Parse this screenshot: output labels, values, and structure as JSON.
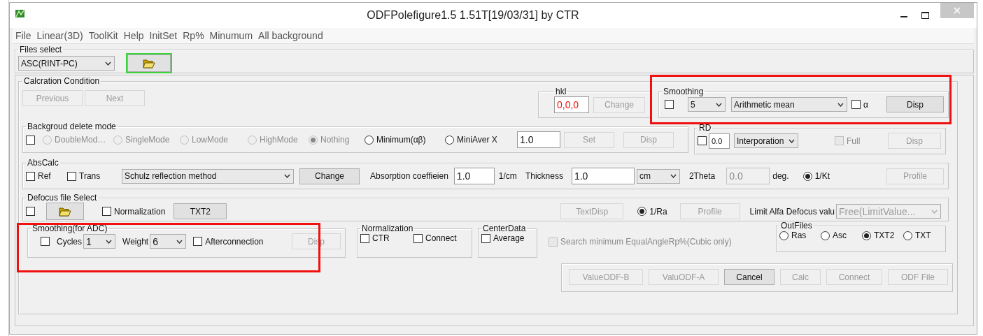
{
  "window": {
    "title": "ODFPolefigure1.5 1.51T[19/03/31] by CTR"
  },
  "menu": [
    "File",
    "Linear(3D)",
    "ToolKit",
    "Help",
    "InitSet",
    "Rp%",
    "Minumum",
    "All background"
  ],
  "files_select": {
    "label": "Files select",
    "format": "ASC(RINT-PC)"
  },
  "calc": {
    "label": "Calcration Condition"
  },
  "nav_buttons": [
    {
      "label": "Previous",
      "disabled": true
    },
    {
      "label": "Next",
      "disabled": true
    }
  ],
  "hkl": {
    "label": "hkl",
    "value": "0,0,0",
    "button": {
      "label": "Change",
      "disabled": true
    }
  },
  "smoothing": {
    "label": "Smoothing",
    "checked": false,
    "size": "5",
    "method": "Arithmetic mean",
    "alpha": {
      "label": "α",
      "checked": false
    },
    "button": {
      "label": "Disp",
      "disabled": false
    }
  },
  "background": {
    "label": "Backgroud delete mode",
    "checked": false,
    "modes": [
      {
        "label": "DoubleMod…",
        "selected": false,
        "disabled": true
      },
      {
        "label": "SingleMode",
        "selected": false,
        "disabled": true
      },
      {
        "label": "LowMode",
        "selected": false,
        "disabled": true
      },
      {
        "label": "HighMode",
        "selected": false,
        "disabled": true
      },
      {
        "label": "Nothing",
        "selected": true,
        "disabled": true
      },
      {
        "label": "Minimum(αβ)",
        "selected": false,
        "disabled": false
      },
      {
        "label": "MiniAver X",
        "selected": false,
        "disabled": false
      }
    ],
    "value": "1.0",
    "buttons": [
      {
        "label": "Set",
        "disabled": true
      },
      {
        "label": "Disp",
        "disabled": true
      }
    ]
  },
  "rd": {
    "label": "RD",
    "checked": false,
    "value": "0.0",
    "method": "Interporation",
    "full": {
      "label": "Full",
      "checked": false,
      "disabled": true
    },
    "button": {
      "label": "Disp",
      "disabled": true
    }
  },
  "abscalc": {
    "label": "AbsCalc",
    "options": [
      {
        "label": "Ref",
        "checked": false
      },
      {
        "label": "Trans",
        "checked": false
      }
    ],
    "method": "Schulz reflection method",
    "button": {
      "label": "Change",
      "disabled": false
    },
    "coef_label": "Absorption coeffieien",
    "coef": "1.0",
    "coef_unit": "1/cm",
    "thickness_label": "Thickness",
    "thickness": "1.0",
    "thickness_unit": "cm",
    "theta_label": "2Theta",
    "theta": "0.0",
    "theta_unit": "deg.",
    "kt": {
      "label": "1/Kt",
      "selected": true
    },
    "profile": {
      "label": "Profile",
      "disabled": true
    }
  },
  "defocus": {
    "label": "Defocus file Select",
    "checked": false,
    "normalization": {
      "label": "Normalization",
      "checked": false
    },
    "txt2": {
      "label": "TXT2",
      "disabled": false
    },
    "textdisp": {
      "label": "TextDisp",
      "disabled": true
    },
    "ra": {
      "label": "1/Ra",
      "selected": true
    },
    "profile": {
      "label": "Profile",
      "disabled": true
    },
    "limit_label": "Limit Alfa Defocus valu",
    "limit": "Free(LimitValue...",
    "limit_disabled": true
  },
  "adc": {
    "label": "Smoothing(for ADC)",
    "checked": false,
    "cycles_label": "Cycles",
    "cycles": "1",
    "weight_label": "Weight",
    "weight": "6",
    "after": {
      "label": "Afterconnection",
      "checked": false
    },
    "button": {
      "label": "Disp",
      "disabled": true
    }
  },
  "normalization": {
    "label": "Normalization",
    "options": [
      {
        "label": "CTR",
        "checked": false
      },
      {
        "label": "Connect",
        "checked": false
      }
    ]
  },
  "center": {
    "label": "CenterData",
    "average": {
      "label": "Average",
      "checked": false
    }
  },
  "search": {
    "label": "Search minimum EqualAngleRp%(Cubic only)",
    "checked": false,
    "disabled": true
  },
  "outfiles": {
    "label": "OutFiles",
    "options": [
      {
        "label": "Ras",
        "selected": false
      },
      {
        "label": "Asc",
        "selected": false
      },
      {
        "label": "TXT2",
        "selected": true
      },
      {
        "label": "TXT",
        "selected": false
      }
    ]
  },
  "actions": [
    {
      "label": "ValueODF-B",
      "disabled": true
    },
    {
      "label": "ValuODF-A",
      "disabled": true
    },
    {
      "label": "Cancel",
      "disabled": false
    },
    {
      "label": "Calc",
      "disabled": true
    },
    {
      "label": "Connect",
      "disabled": true
    },
    {
      "label": "ODF File",
      "disabled": true
    }
  ]
}
